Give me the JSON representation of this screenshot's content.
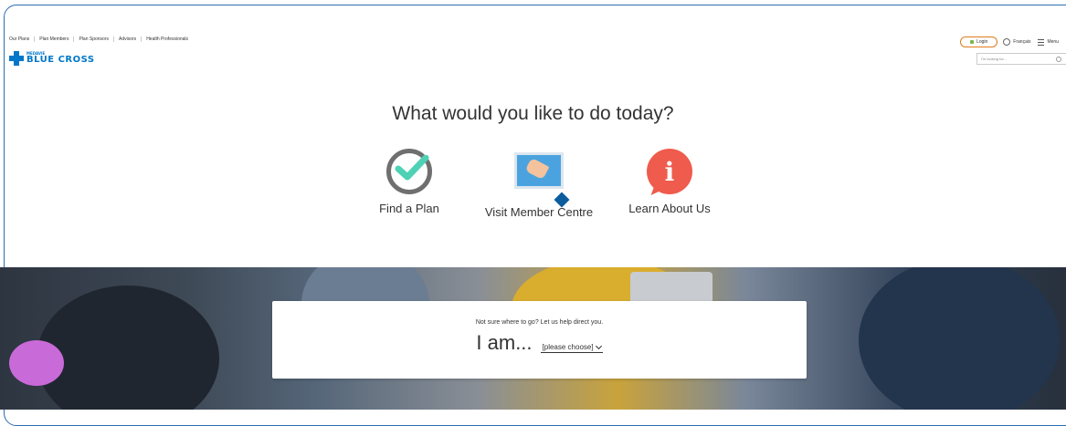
{
  "nav": {
    "items": [
      "Our Plans",
      "Plan Members",
      "Plan Sponsors",
      "Advisors",
      "Health Professionals"
    ]
  },
  "logo": {
    "small": "MEDAVIE",
    "big": "BLUE CROSS"
  },
  "utility": {
    "login": "Login",
    "language": "Français",
    "menu": "Menu"
  },
  "search": {
    "placeholder": "I'm looking for..."
  },
  "main": {
    "heading": "What would you like to do today?",
    "options": [
      {
        "label": "Find a Plan",
        "icon": "check-circle-icon"
      },
      {
        "label": "Visit Member Centre",
        "icon": "touch-screen-icon"
      },
      {
        "label": "Learn About Us",
        "icon": "info-bubble-icon"
      }
    ]
  },
  "helper": {
    "hint": "Not sure where to go? Let us help direct you.",
    "lead": "I am...",
    "select_value": "[please choose]"
  },
  "colors": {
    "brand": "#0077c8",
    "accent_highlight": "#e07b1f",
    "info": "#ef5b4c",
    "check": "#4fd1b5"
  }
}
